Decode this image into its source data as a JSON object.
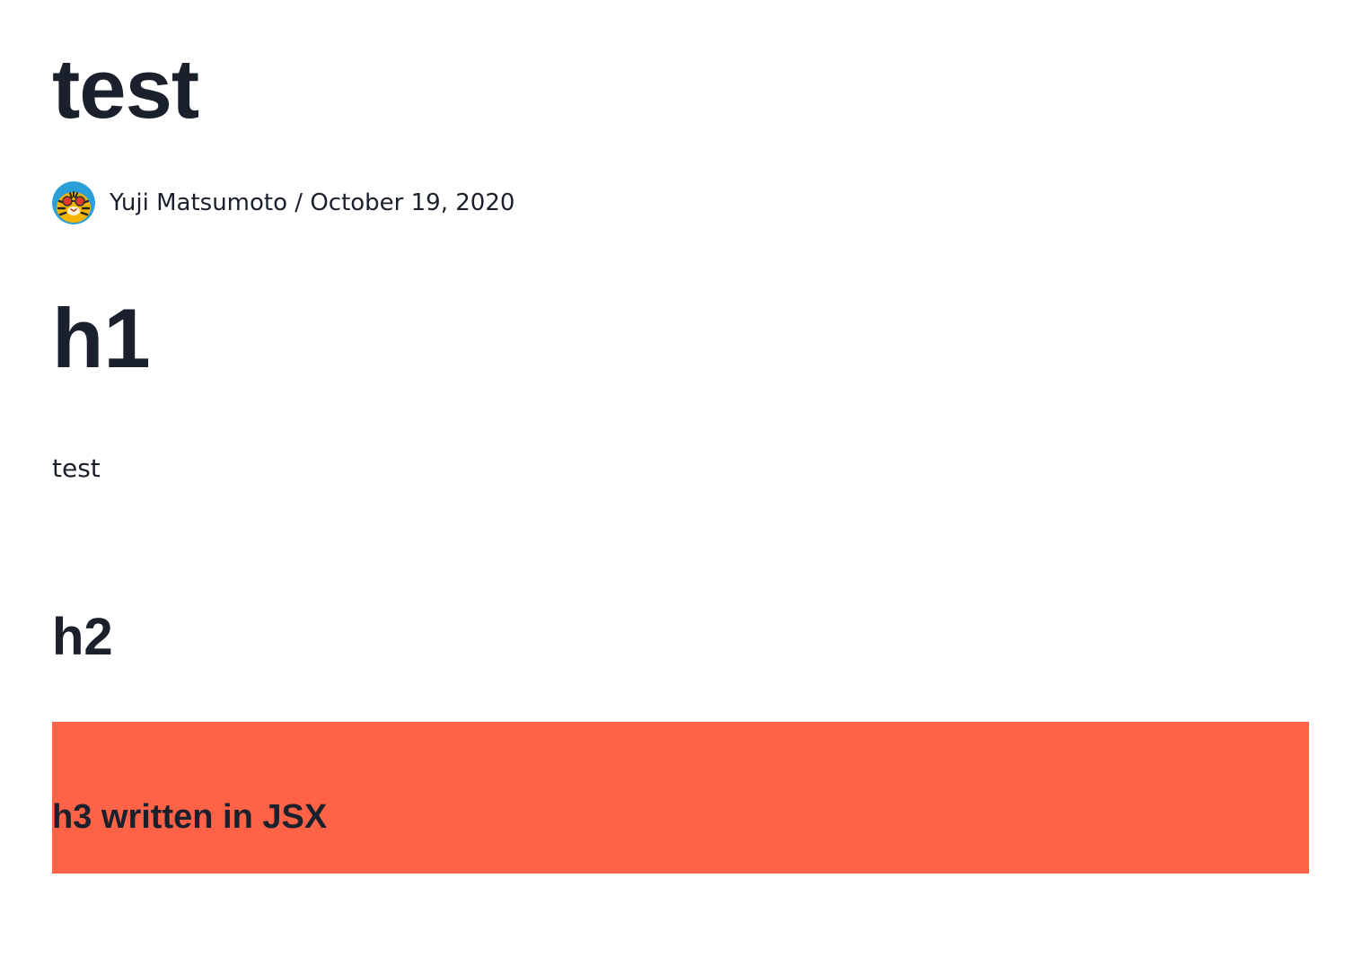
{
  "post": {
    "title": "test",
    "author": "Yuji Matsumoto",
    "separator": "/",
    "date": "October 19, 2020",
    "avatar_icon": "tiger-avatar-icon"
  },
  "content": {
    "h1": "h1",
    "paragraph": "test",
    "h2": "h2",
    "h3": "h3 written in JSX"
  },
  "colors": {
    "text": "#1a202c",
    "jsx_box_background": "#ff6347",
    "background": "#ffffff"
  }
}
